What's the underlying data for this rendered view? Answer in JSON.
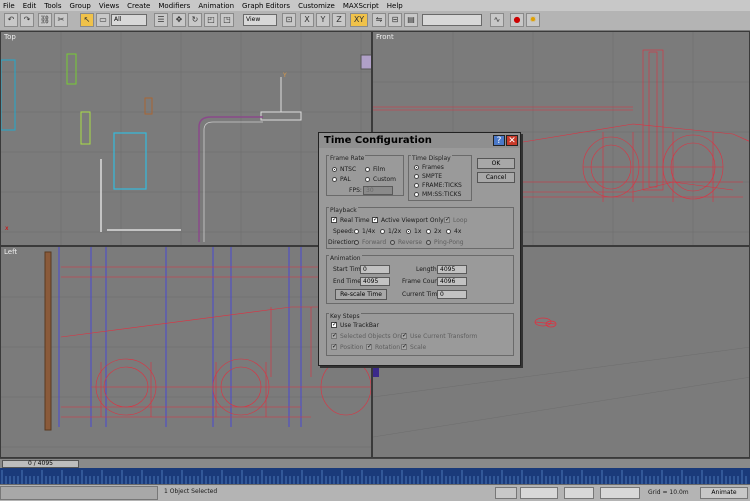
{
  "menu": [
    "File",
    "Edit",
    "Tools",
    "Group",
    "Views",
    "Create",
    "Modifiers",
    "Animation",
    "Graph Editors",
    "Customize",
    "MAXScript",
    "Help"
  ],
  "toolbar": {
    "selection_filter": "All",
    "ref_coord": "View",
    "axis_constraint": "XY"
  },
  "viewports": {
    "top": "Top",
    "front": "Front",
    "left": "Left"
  },
  "dialog": {
    "title": "Time Configuration",
    "help": "?",
    "close": "✕",
    "frame_rate": {
      "title": "Frame Rate",
      "ntsc": "NTSC",
      "film": "Film",
      "pal": "PAL",
      "custom": "Custom",
      "fps_label": "FPS:",
      "fps_value": "30"
    },
    "time_display": {
      "title": "Time Display",
      "frames": "Frames",
      "smpte": "SMPTE",
      "frame_ticks": "FRAME:TICKS",
      "mm_ss_ticks": "MM:SS:TICKS"
    },
    "ok": "OK",
    "cancel": "Cancel",
    "playback": {
      "title": "Playback",
      "real_time": "Real Time",
      "active_viewport_only": "Active Viewport Only",
      "loop": "Loop",
      "speed_label": "Speed:",
      "speeds": [
        "1/4x",
        "1/2x",
        "1x",
        "2x",
        "4x"
      ],
      "direction_label": "Direction:",
      "directions": [
        "Forward",
        "Reverse",
        "Ping-Pong"
      ]
    },
    "animation": {
      "title": "Animation",
      "start_time_label": "Start Time:",
      "start_time": "0",
      "length_label": "Length:",
      "length": "4095",
      "end_time_label": "End Time:",
      "end_time": "4095",
      "frame_count_label": "Frame Count:",
      "frame_count": "4096",
      "rescale": "Re-scale Time",
      "current_time_label": "Current Time:",
      "current_time": "0"
    },
    "key_steps": {
      "title": "Key Steps",
      "use_trackbar": "Use TrackBar",
      "selected_objects_only": "Selected Objects Only",
      "use_current_transform": "Use Current Transform",
      "position": "Position",
      "rotation": "Rotation",
      "scale": "Scale"
    }
  },
  "time_slider": "0 / 4095",
  "status": {
    "selection": "1 Object Selected",
    "grid": "Grid = 10.0m",
    "animate": "Animate"
  },
  "colors": {
    "wireframe": "#e03040",
    "viewport_bg": "#7b7b7b",
    "dialog_bg": "#9a9a9a",
    "trackbar": "#1a3a7a"
  }
}
